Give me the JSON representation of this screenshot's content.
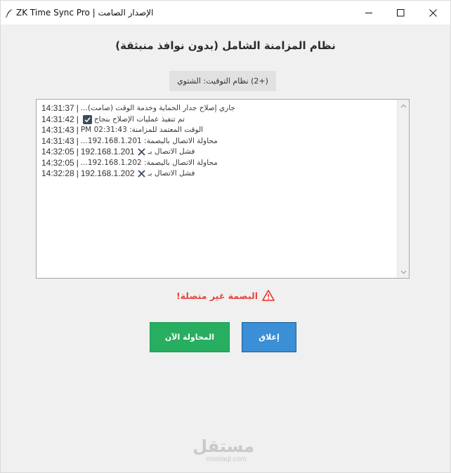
{
  "window": {
    "title": "ZK Time Sync Pro | الإصدار الصامت",
    "icon": "feather-icon"
  },
  "heading": "نظام المزامنة الشامل (بدون نوافذ منبثقة)",
  "timezone_label": "(+2) نظام التوقيت: الشتوي",
  "log": [
    {
      "time": "14:31:37",
      "icon": "",
      "ip": "",
      "message": "جاري إصلاح جدار الحماية وخدمة الوقت (صامت)..."
    },
    {
      "time": "14:31:42",
      "icon": "check-icon",
      "ip": "",
      "message": "تم تنفيذ عمليات الإصلاح بنجاح"
    },
    {
      "time": "14:31:43",
      "icon": "",
      "ip": "",
      "message": "الوقت المعتمد للمزامنة: 02:31:43 PM"
    },
    {
      "time": "14:31:43",
      "icon": "",
      "ip": "",
      "message": "محاولة الاتصال بالبصمة: 192.168.1.201..."
    },
    {
      "time": "14:32:05",
      "icon": "x-icon",
      "ip": "192.168.1.201",
      "message": "فشل الاتصال بـ"
    },
    {
      "time": "14:32:05",
      "icon": "",
      "ip": "",
      "message": "محاولة الاتصال بالبصمة: 192.168.1.202..."
    },
    {
      "time": "14:32:28",
      "icon": "x-icon",
      "ip": "192.168.1.202",
      "message": "فشل الاتصال بـ"
    }
  ],
  "status": {
    "icon": "warning-icon",
    "text": "البصمة غير متصلة!",
    "color": "#e8463d"
  },
  "buttons": {
    "retry": {
      "label": "المحاولة الآن",
      "color": "#27ae60"
    },
    "close": {
      "label": "إغلاق",
      "color": "#3a8fd6"
    }
  },
  "watermark": {
    "logo": "مستقل",
    "site": "mostaql.com"
  }
}
